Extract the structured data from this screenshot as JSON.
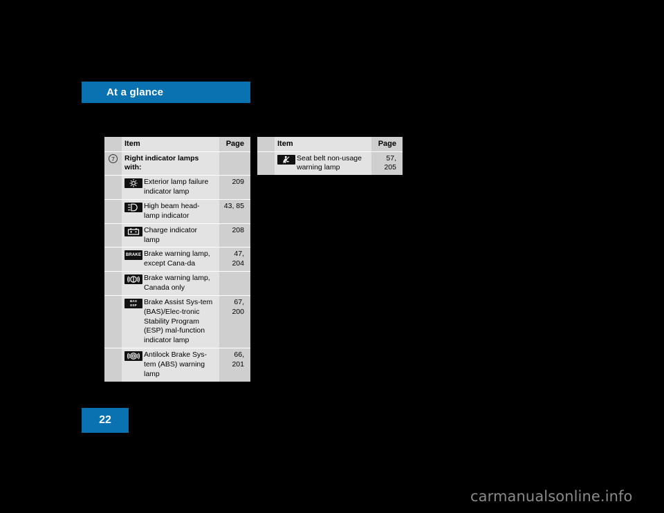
{
  "chapter": {
    "title": "At a glance"
  },
  "page_number": "22",
  "watermark": "carmanualsonline.info",
  "colors": {
    "accent": "#0a72b0",
    "table_bg": "#e3e3e3",
    "table_alt": "#cfcfcf",
    "header_bg": "#d2d2d2"
  },
  "tables": {
    "left": {
      "headers": {
        "item": "Item",
        "page": "Page"
      },
      "marker": "7",
      "group_label": "Right indicator lamps with:",
      "rows": [
        {
          "icon": "exterior-lamp-failure-icon",
          "item": "Exterior lamp failure indicator lamp",
          "page": "209"
        },
        {
          "icon": "high-beam-headlamp-icon",
          "item": "High beam head-lamp indicator",
          "page": "43, 85"
        },
        {
          "icon": "charge-indicator-icon",
          "item": "Charge indicator lamp",
          "page": "208"
        },
        {
          "icon": "brake-text-icon",
          "item": "Brake warning lamp, except Cana-da",
          "page": "47,\n204"
        },
        {
          "icon": "brake-circle-icon",
          "item": "Brake warning lamp, Canada only",
          "page": ""
        },
        {
          "icon": "bas-esp-icon",
          "item": "Brake Assist Sys-tem (BAS)/Elec-tronic Stability Program (ESP) mal-function indicator lamp",
          "page": "67,\n200"
        },
        {
          "icon": "abs-icon",
          "item": "Antilock Brake Sys-tem (ABS) warning lamp",
          "page": "66,\n201"
        }
      ]
    },
    "right": {
      "headers": {
        "item": "Item",
        "page": "Page"
      },
      "rows": [
        {
          "icon": "seat-belt-warning-icon",
          "item": "Seat belt non-usage warning lamp",
          "page": "57,\n205"
        }
      ]
    }
  }
}
